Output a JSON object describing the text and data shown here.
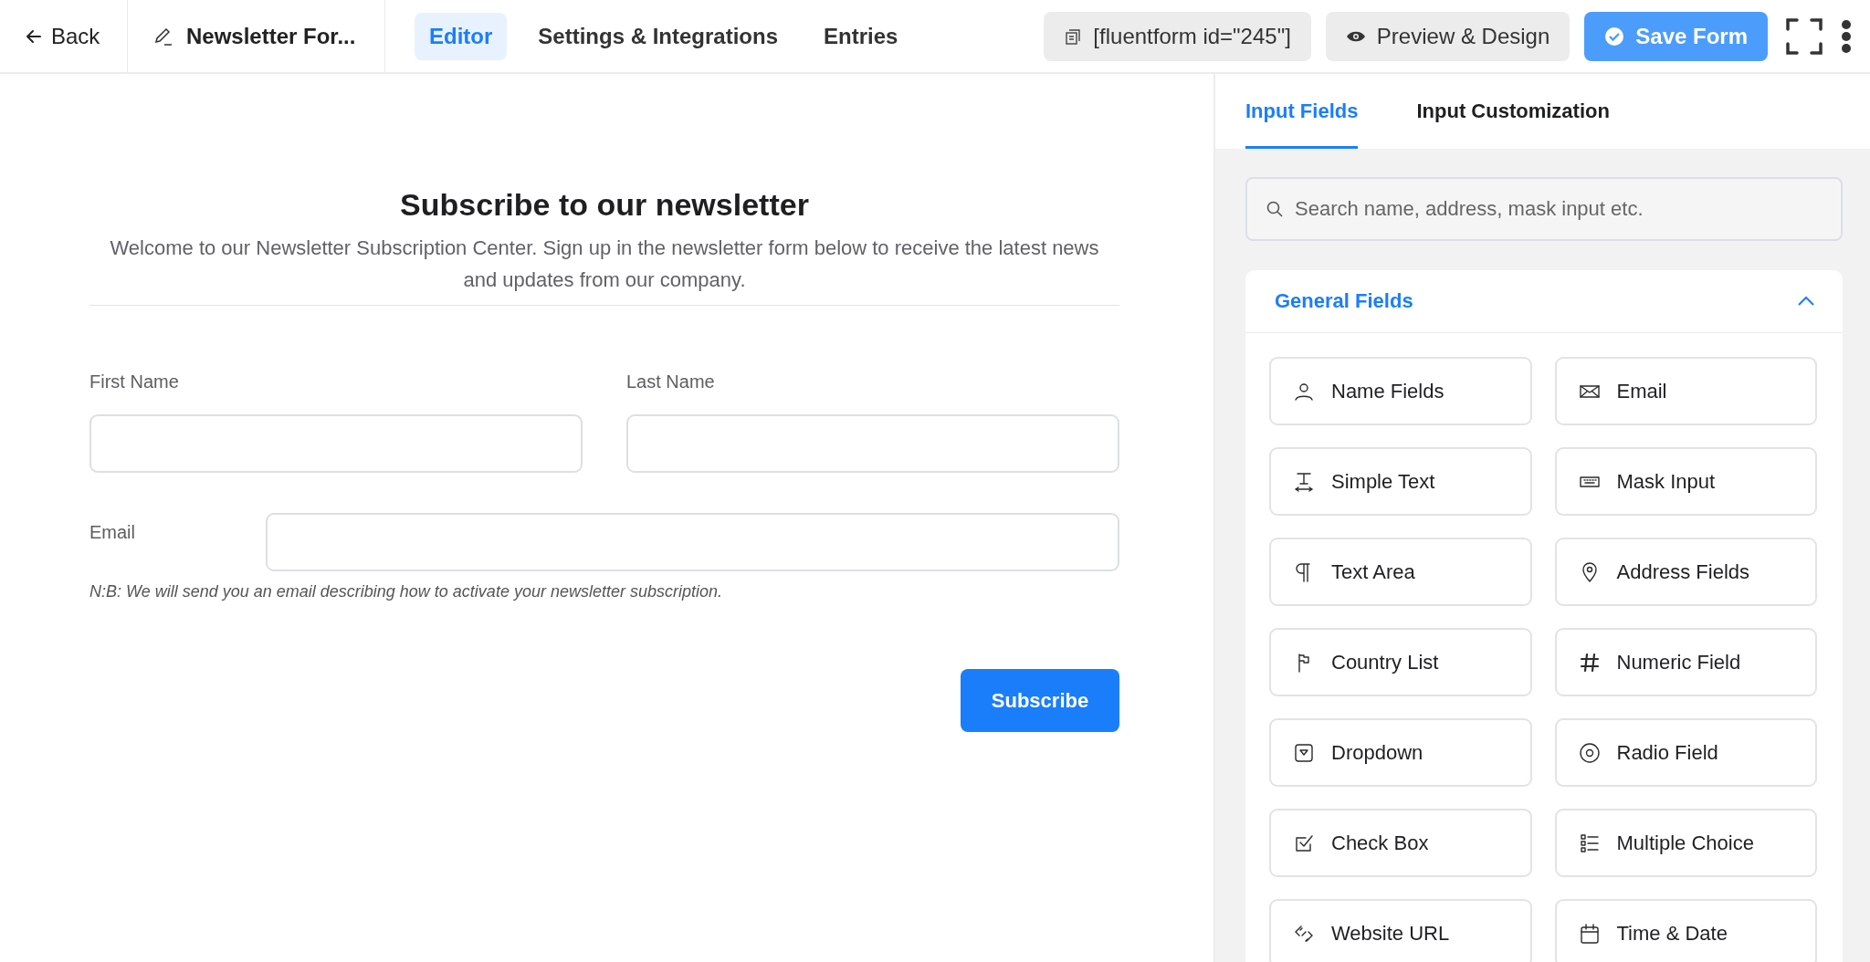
{
  "topbar": {
    "back": "Back",
    "form_name": "Newsletter For...",
    "tabs": [
      {
        "label": "Editor",
        "selected": true
      },
      {
        "label": "Settings & Integrations",
        "selected": false
      },
      {
        "label": "Entries",
        "selected": false
      }
    ],
    "shortcode": "[fluentform id=\"245\"]",
    "preview": "Preview & Design",
    "save": "Save Form"
  },
  "form": {
    "title": "Subscribe to our newsletter",
    "description": "Welcome to our Newsletter Subscription Center. Sign up in the newsletter form below to receive the latest news and updates from our company.",
    "first_name_label": "First Name",
    "last_name_label": "Last Name",
    "email_label": "Email",
    "note": "N:B: We will send you an email describing how to activate your newsletter subscription.",
    "submit": "Subscribe"
  },
  "sidebar": {
    "tabs": [
      {
        "label": "Input Fields",
        "selected": true
      },
      {
        "label": "Input Customization",
        "selected": false
      }
    ],
    "search": {
      "placeholder": "Search name, address, mask input etc."
    },
    "section": {
      "title": "General Fields",
      "expanded": true,
      "items": [
        {
          "label": "Name Fields",
          "kind": "name"
        },
        {
          "label": "Email",
          "kind": "email"
        },
        {
          "label": "Simple Text",
          "kind": "text"
        },
        {
          "label": "Mask Input",
          "kind": "mask"
        },
        {
          "label": "Text Area",
          "kind": "textarea"
        },
        {
          "label": "Address Fields",
          "kind": "address"
        },
        {
          "label": "Country List",
          "kind": "country"
        },
        {
          "label": "Numeric Field",
          "kind": "numeric"
        },
        {
          "label": "Dropdown",
          "kind": "dropdown"
        },
        {
          "label": "Radio Field",
          "kind": "radio"
        },
        {
          "label": "Check Box",
          "kind": "checkbox"
        },
        {
          "label": "Multiple Choice",
          "kind": "choice"
        },
        {
          "label": "Website URL",
          "kind": "url"
        },
        {
          "label": "Time & Date",
          "kind": "datetime"
        }
      ]
    }
  }
}
